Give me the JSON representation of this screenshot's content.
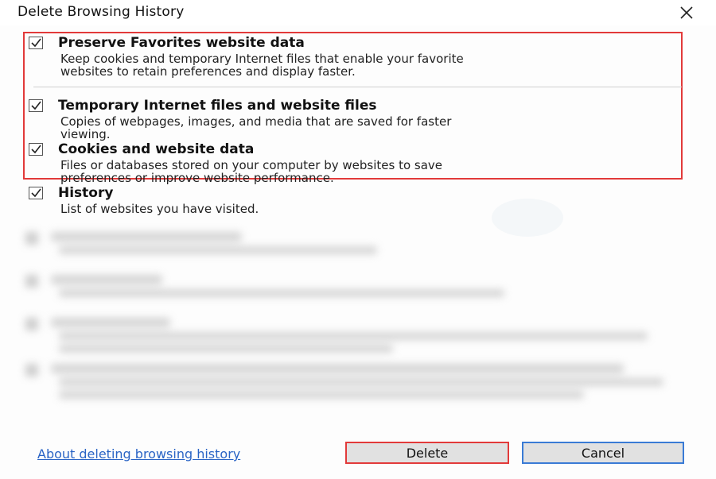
{
  "window": {
    "title": "Delete Browsing History"
  },
  "options": [
    {
      "label": "Preserve Favorites website data",
      "checked": true,
      "description_lines": [
        "Keep cookies and temporary Internet files that enable your favorite",
        "websites to retain preferences and display faster."
      ]
    },
    {
      "label": "Temporary Internet files and website files",
      "checked": true,
      "description_lines": [
        "Copies of webpages, images, and media that are saved for faster",
        "viewing."
      ]
    },
    {
      "label": "Cookies and website data",
      "checked": true,
      "description_lines": [
        "Files or databases stored on your computer by websites to save",
        "preferences or improve website performance."
      ]
    },
    {
      "label": "History",
      "checked": true,
      "description_lines": [
        "List of websites you have visited."
      ]
    }
  ],
  "footer": {
    "help_link": "About deleting browsing history",
    "delete_label": "Delete",
    "cancel_label": "Cancel"
  },
  "colors": {
    "highlight": "#e23a3a",
    "link": "#2a64c5",
    "cancel_border": "#3a7bd5"
  }
}
